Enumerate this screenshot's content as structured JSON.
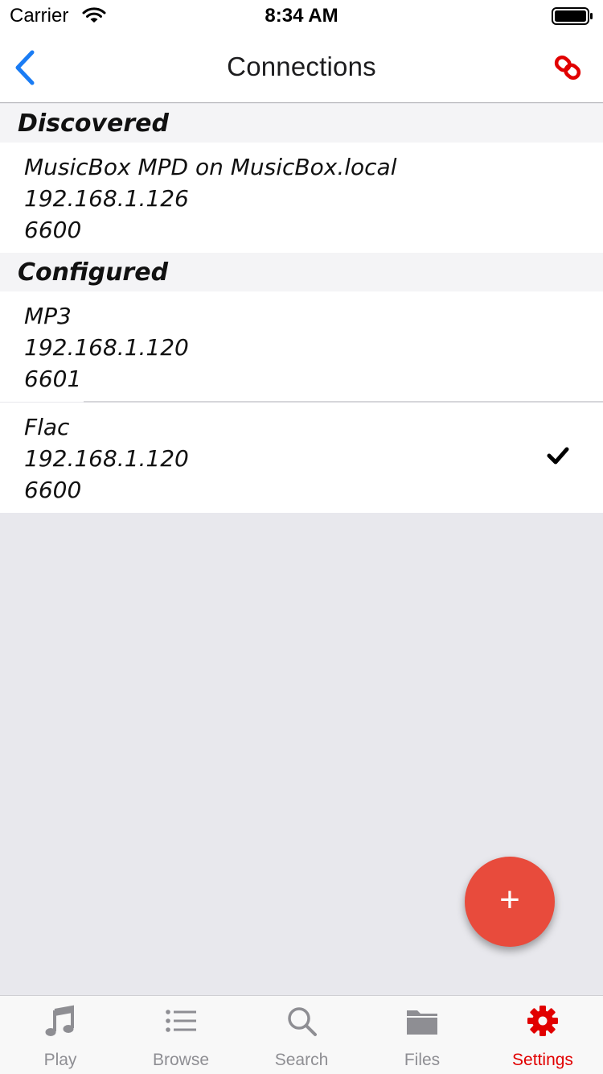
{
  "status_bar": {
    "carrier": "Carrier",
    "time": "8:34 AM"
  },
  "nav": {
    "title": "Connections",
    "back_icon": "chevron-left-icon",
    "action_icon": "link-icon"
  },
  "sections": {
    "discovered": {
      "header": "Discovered",
      "items": [
        {
          "name": "MusicBox MPD on MusicBox.local",
          "host": "192.168.1.126",
          "port": "6600"
        }
      ]
    },
    "configured": {
      "header": "Configured",
      "items": [
        {
          "name": "MP3",
          "host": "192.168.1.120",
          "port": "6601",
          "selected": false
        },
        {
          "name": "Flac",
          "host": "192.168.1.120",
          "port": "6600",
          "selected": true
        }
      ]
    }
  },
  "fab": {
    "label": "+"
  },
  "tabs": [
    {
      "label": "Play",
      "icon": "music-note-icon",
      "active": false
    },
    {
      "label": "Browse",
      "icon": "list-icon",
      "active": false
    },
    {
      "label": "Search",
      "icon": "search-icon",
      "active": false
    },
    {
      "label": "Files",
      "icon": "folder-icon",
      "active": false
    },
    {
      "label": "Settings",
      "icon": "gear-icon",
      "active": true
    }
  ],
  "colors": {
    "accent_blue": "#1a7cf4",
    "accent_red": "#e10000",
    "fab_red": "#e84b3c",
    "background": "#e8e8ed"
  }
}
